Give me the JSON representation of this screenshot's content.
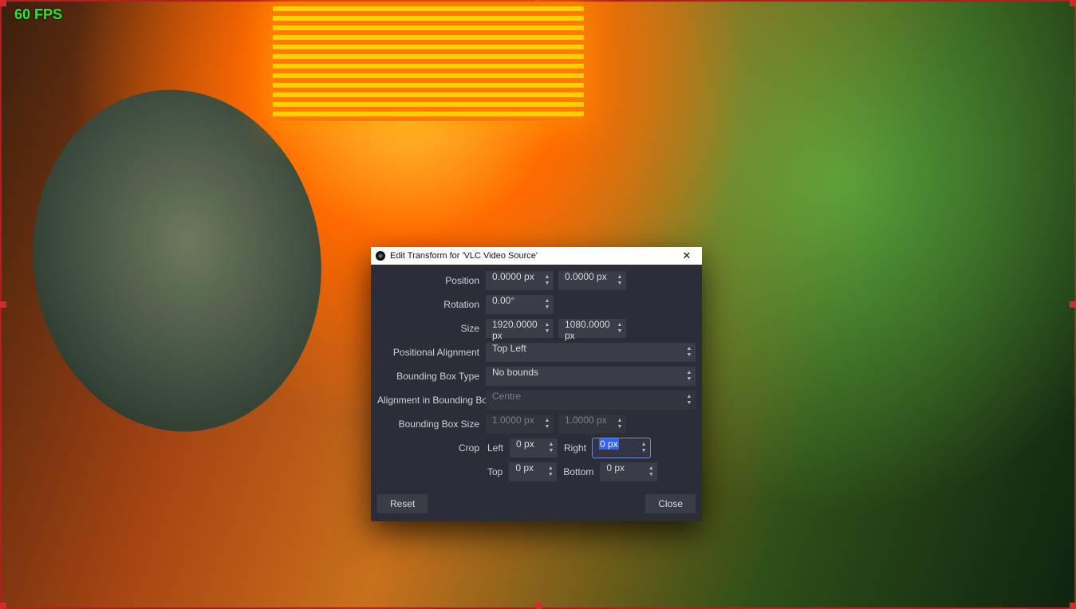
{
  "overlay": {
    "fps": "60 FPS"
  },
  "dialog": {
    "title": "Edit Transform for 'VLC Video Source'",
    "labels": {
      "position": "Position",
      "rotation": "Rotation",
      "size": "Size",
      "positional_alignment": "Positional Alignment",
      "bounding_box_type": "Bounding Box Type",
      "alignment_in_bb": "Alignment in Bounding Box",
      "bounding_box_size": "Bounding Box Size",
      "crop": "Crop",
      "left": "Left",
      "right": "Right",
      "top": "Top",
      "bottom": "Bottom"
    },
    "values": {
      "position_x": "0.0000 px",
      "position_y": "0.0000 px",
      "rotation": "0.00°",
      "size_w": "1920.0000 px",
      "size_h": "1080.0000 px",
      "positional_alignment": "Top Left",
      "bounding_box_type": "No bounds",
      "alignment_in_bb": "Centre",
      "bb_size_w": "1.0000 px",
      "bb_size_h": "1.0000 px",
      "crop_left": "0 px",
      "crop_right": "0 px",
      "crop_top": "0 px",
      "crop_bottom": "0 px"
    },
    "buttons": {
      "reset": "Reset",
      "close": "Close"
    }
  }
}
